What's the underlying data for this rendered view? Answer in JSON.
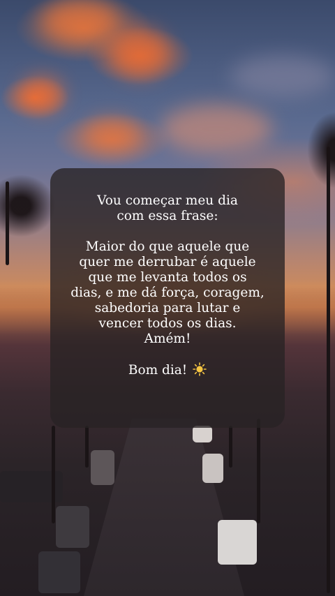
{
  "message": {
    "intro_lines": [
      "Vou começar meu dia",
      "com essa frase:"
    ],
    "quote_lines": [
      "Maior do que aquele que",
      "quer me derrubar é aquele",
      "que me levanta todos os",
      "dias, e me dá força, coragem,",
      "sabedoria para lutar e",
      "vencer todos os dias.",
      "Amém!"
    ],
    "closing": "Bom dia!",
    "closing_icon": "sun-icon"
  },
  "colors": {
    "card_background": "#282224",
    "text": "#ffffff",
    "sun": "#f5c542"
  }
}
